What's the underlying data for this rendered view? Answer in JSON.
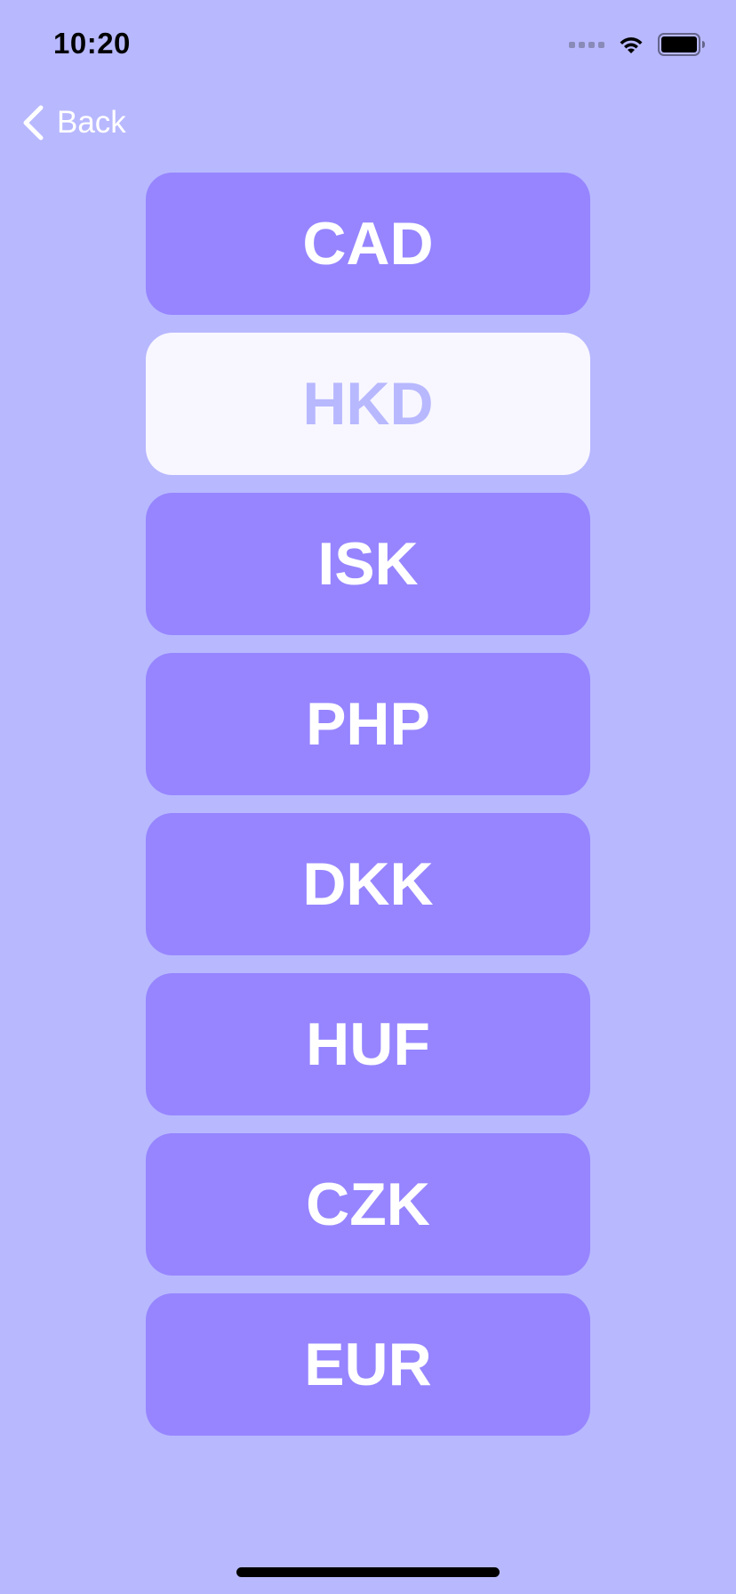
{
  "status_bar": {
    "time": "10:20",
    "icons": [
      "cellular-signal-icon",
      "wifi-icon",
      "battery-icon"
    ]
  },
  "nav": {
    "back_label": "Back",
    "back_icon": "chevron-left-icon"
  },
  "currencies": [
    {
      "code": "CAD",
      "selected": false
    },
    {
      "code": "HKD",
      "selected": true
    },
    {
      "code": "ISK",
      "selected": false
    },
    {
      "code": "PHP",
      "selected": false
    },
    {
      "code": "DKK",
      "selected": false
    },
    {
      "code": "HUF",
      "selected": false
    },
    {
      "code": "CZK",
      "selected": false
    },
    {
      "code": "EUR",
      "selected": false
    }
  ],
  "colors": {
    "background": "#b8b8ff",
    "button": "#9685ff",
    "selected_button": "#f8f7ff",
    "selected_text": "#b8b8ff",
    "text": "#ffffff"
  }
}
